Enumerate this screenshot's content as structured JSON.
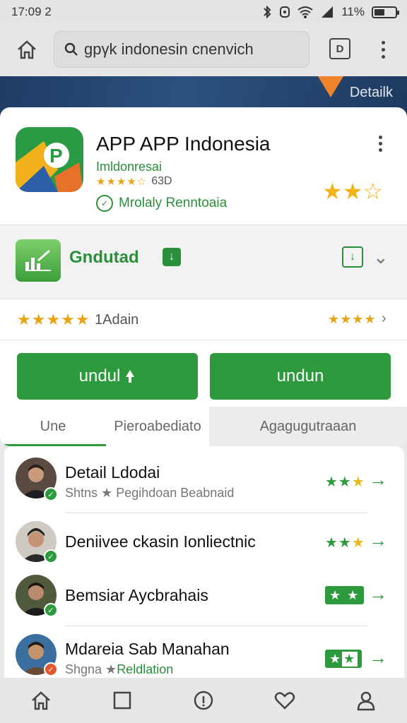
{
  "status_bar": {
    "time": "17:09 2",
    "battery_text": "11%",
    "battery_level": 0.55
  },
  "top_bar": {
    "search_value": "gpγk indonesin cnenvich",
    "tab_icon": "tab-switcher-icon"
  },
  "banner": {
    "label": "Detailk"
  },
  "app": {
    "title": "APP APP Indonesia",
    "developer": "Imldonresai",
    "rating_text": "63D",
    "verified_label": "Mrolaly Renntoaia",
    "big_stars": "★★☆"
  },
  "section": {
    "label": "Gndutad"
  },
  "rating": {
    "count_label": "1Adain",
    "stars_left": "★★★★★",
    "stars_right": "★★★★"
  },
  "buttons": {
    "left": "undul",
    "right": "undun"
  },
  "tabs": [
    "Une",
    "Pieroabediato",
    "Agagugutraaan"
  ],
  "list": [
    {
      "title": "Detail Ldodai",
      "subtitle_a": "Shtns ★",
      "subtitle_b": "Pegihdoan Beabnaid"
    },
    {
      "title": "Deniivee ckasin Ionliectnic"
    },
    {
      "title": "Bemsiar Aycbrahais"
    },
    {
      "title": "Mdareia Sab Manahan",
      "subtitle_a": "Shgna ★",
      "subtitle_b": "Reldlation"
    }
  ],
  "colors": {
    "brand_green": "#2c9a3d",
    "star_gold": "#e8a317",
    "banner_blue": "#1f3c64"
  }
}
